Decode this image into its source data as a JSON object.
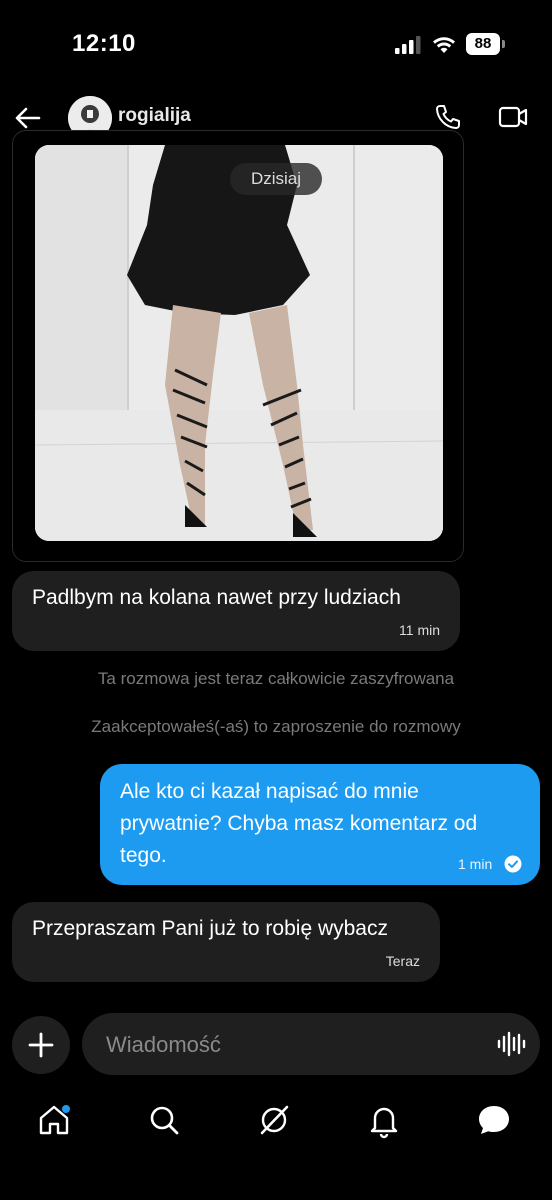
{
  "status_bar": {
    "time": "12:10",
    "battery": "88",
    "battery_level": 88
  },
  "header": {
    "back_icon": "arrow-left-icon",
    "contact_name": "rogialija",
    "phone_icon": "phone-icon",
    "video_icon": "video-camera-icon"
  },
  "conversation": {
    "date_divider": "Dzisiaj",
    "messages": [
      {
        "side": "incoming",
        "text": "Padlbym na kolana nawet przy ludziach",
        "time": "11 min"
      },
      {
        "side": "outgoing",
        "text_lines": [
          "Ale kto ci kazał napisać do mnie",
          "prywatnie? Chyba masz komentarz od",
          "tego."
        ],
        "time": "1 min",
        "status": "read"
      },
      {
        "side": "incoming",
        "text": "Przepraszam Pani już to robię wybacz",
        "time": "Teraz"
      }
    ],
    "system_notices": [
      "Ta rozmowa jest teraz całkowicie zaszyfrowana",
      "Zaakceptowałeś(-aś) to zaproszenie do rozmowy"
    ]
  },
  "composer": {
    "placeholder": "Wiadomość",
    "add_icon": "plus-icon",
    "voice_icon": "voice-wave-icon"
  },
  "tabbar": {
    "items": [
      "home-icon",
      "search-icon",
      "grok-icon",
      "bell-icon",
      "messages-icon"
    ],
    "active": "messages-icon",
    "home_has_dot": true
  },
  "colors": {
    "accent": "#1d9bf0",
    "bubble_incoming": "#1f1f1f",
    "background": "#000000",
    "system_text": "#7a7a7a"
  }
}
